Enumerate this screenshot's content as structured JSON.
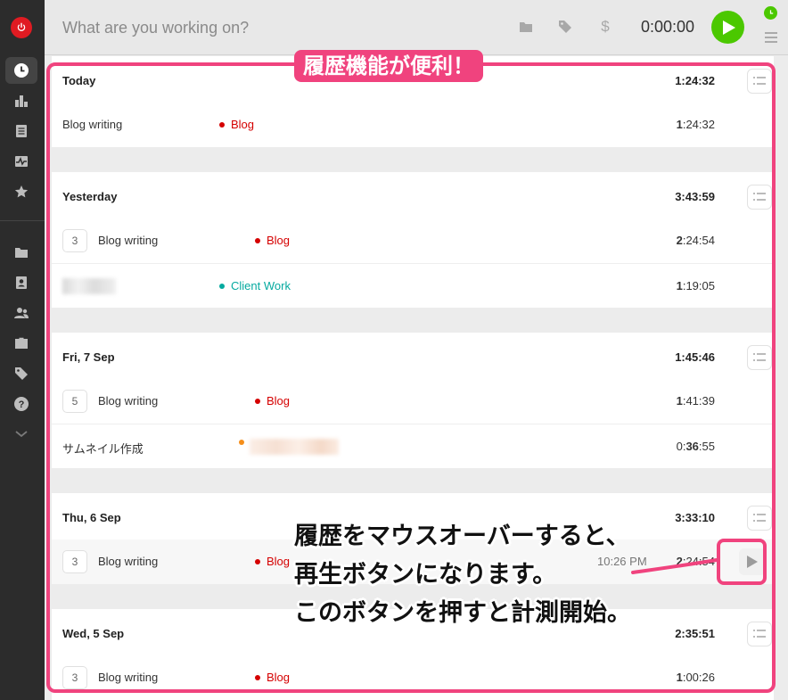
{
  "topbar": {
    "placeholder": "What are you working on?",
    "timer": "0:00:00",
    "billable_symbol": "$"
  },
  "colors": {
    "accent_green": "#4bc800",
    "blog_project": "#d50000",
    "client_project": "#06aaa0",
    "orange_project": "#f58e1a",
    "annotation_pink": "#f0437e",
    "sidebar_bg": "#2c2c2c"
  },
  "sidebar": {
    "items": [
      {
        "icon": "clock-icon"
      },
      {
        "icon": "bar-chart-icon"
      },
      {
        "icon": "document-icon"
      },
      {
        "icon": "activity-icon"
      },
      {
        "icon": "star-icon"
      },
      {
        "icon": "folder-icon"
      },
      {
        "icon": "contact-card-icon"
      },
      {
        "icon": "team-icon"
      },
      {
        "icon": "briefcase-icon"
      },
      {
        "icon": "tag-icon"
      },
      {
        "icon": "help-icon"
      },
      {
        "icon": "chevron-down-icon"
      }
    ]
  },
  "groups": [
    {
      "title": "Today",
      "total_bold": "1",
      "total_rest": ":24:32",
      "entries": [
        {
          "description": "Blog writing",
          "project": "Blog",
          "dur_bold": "1",
          "dur_rest": ":24:32"
        }
      ]
    },
    {
      "title": "Yesterday",
      "total_bold": "3",
      "total_rest": ":43:59",
      "entries": [
        {
          "count": "3",
          "description": "Blog writing",
          "project": "Blog",
          "dur_bold": "2",
          "dur_rest": ":24:54"
        },
        {
          "project": "Client Work",
          "dur_bold": "1",
          "dur_rest": ":19:05"
        }
      ]
    },
    {
      "title": "Fri, 7 Sep",
      "total_bold": "1",
      "total_rest": ":45:46",
      "entries": [
        {
          "count": "5",
          "description": "Blog writing",
          "project": "Blog",
          "dur_bold": "1",
          "dur_rest": ":41:39"
        },
        {
          "description": "サムネイル作成",
          "dur_pre": "0:",
          "dur_bold": "36",
          "dur_rest": ":55"
        }
      ]
    },
    {
      "title": "Thu, 6 Sep",
      "total_bold": "3",
      "total_rest": ":33:10",
      "entries": [
        {
          "count": "3",
          "description": "Blog writing",
          "project": "Blog",
          "time_range": "10:26 PM",
          "dur_bold": "2",
          "dur_rest": ":24:54"
        }
      ]
    },
    {
      "title": "Wed, 5 Sep",
      "total_bold": "2",
      "total_rest": ":35:51",
      "entries": [
        {
          "count": "3",
          "description": "Blog writing",
          "project": "Blog",
          "dur_bold": "1",
          "dur_rest": ":00:26"
        }
      ]
    }
  ],
  "annotations": {
    "label": "履歴機能が便利！",
    "lines": [
      "履歴をマウスオーバーすると、",
      "再生ボタンになります。",
      "このボタンを押すと計測開始。"
    ]
  }
}
